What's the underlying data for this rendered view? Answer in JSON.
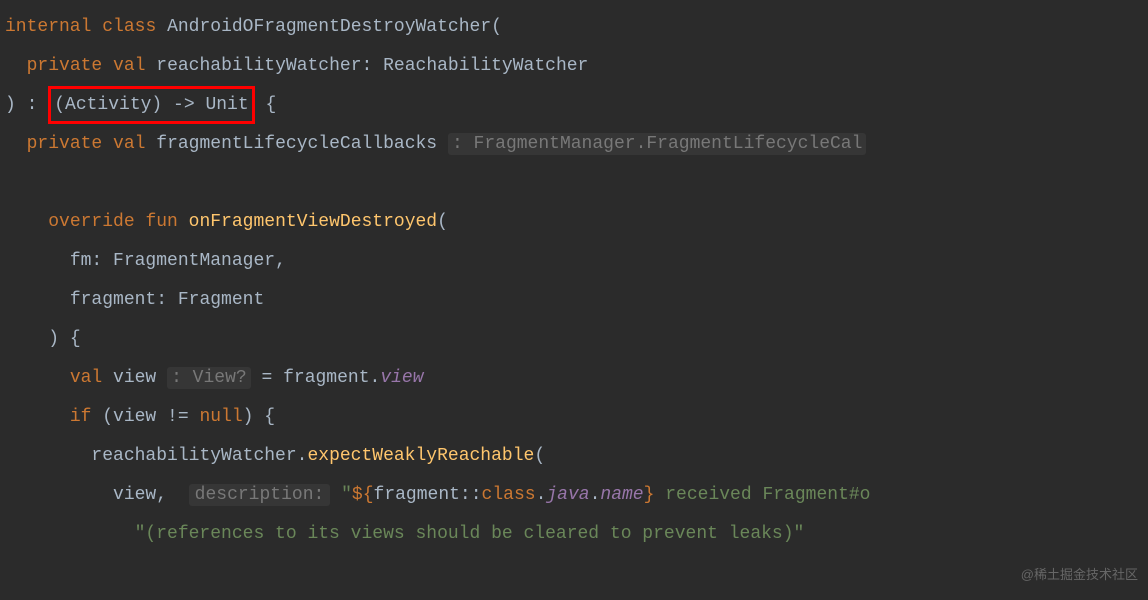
{
  "line1": {
    "internal": "internal",
    "class": "class",
    "className": "AndroidOFragmentDestroyWatcher",
    "paren": "("
  },
  "line2": {
    "private": "private",
    "val": "val",
    "propName": "reachabilityWatcher",
    "colon": ": ",
    "type": "ReachabilityWatcher"
  },
  "line3": {
    "close": ") : ",
    "boxed": "(Activity) -> Unit",
    "brace": " {"
  },
  "line4": {
    "private": "private",
    "val": "val",
    "propName": "fragmentLifecycleCallbacks",
    "hint": ": FragmentManager.FragmentLifecycleCal"
  },
  "line5": {
    "override": "override",
    "fun": "fun",
    "method": "onFragmentViewDestroyed",
    "paren": "("
  },
  "line6": {
    "param": "fm",
    "colon": ": ",
    "type": "FragmentManager",
    "comma": ","
  },
  "line7": {
    "param": "fragment",
    "colon": ": ",
    "type": "Fragment"
  },
  "line8": {
    "close": ") {"
  },
  "line9": {
    "val": "val",
    "varName": "view",
    "hint": ": View?",
    "eq": " = fragment.",
    "prop": "view"
  },
  "line10": {
    "if": "if",
    "cond1": " (view != ",
    "null": "null",
    "cond2": ") {"
  },
  "line11": {
    "obj": "reachabilityWatcher.",
    "method": "expectWeaklyReachable",
    "paren": "("
  },
  "line12": {
    "arg1": "view",
    "comma": ", ",
    "hint": "description:",
    "str1": " \"",
    "tmpl1": "${",
    "expr": "fragment::",
    "kw_class": "class",
    "dot": ".",
    "java": "java",
    "dot2": ".",
    "name": "name",
    "tmpl2": "}",
    "str2": " received Fragment#o"
  },
  "line13": {
    "str": "\"(references to its views should be cleared to prevent leaks)\""
  },
  "watermark": "@稀土掘金技术社区"
}
